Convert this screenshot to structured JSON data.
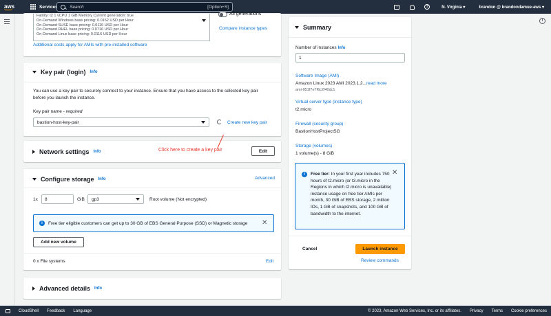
{
  "topnav": {
    "logo": "aws",
    "services_label": "Services",
    "search_placeholder": "Search",
    "search_shortcut": "[Option+S]",
    "region": "N. Virginia ▾",
    "user": "brandon @ brandondamue-aws ▾"
  },
  "ami": {
    "details": [
      "Family: t2    1 vCPU    1 GiB Memory    Current generation: true",
      "On-Demand Windows base pricing: 0.0162 USD per Hour",
      "On-Demand SUSE base pricing: 0.0116 USD per Hour",
      "On-Demand RHEL base pricing: 0.0716 USD per Hour",
      "On-Demand Linux base pricing: 0.0116 USD per Hour"
    ],
    "all_generations": "All generations",
    "compare_link": "Compare instance types",
    "costs_link": "Additional costs apply for AMIs with pre-installed software"
  },
  "keypair": {
    "title": "Key pair (login)",
    "info": "Info",
    "description": "You can use a key pair to securely connect to your instance. Ensure that you have access to the selected key pair before you launch the instance.",
    "field_label": "Key pair name - ",
    "field_required": "required",
    "value": "bastion-host-key-pair",
    "create_link": "Create new key pair"
  },
  "network": {
    "title": "Network settings",
    "info": "Info",
    "edit_label": "Edit"
  },
  "annotation": {
    "text": "Click here  to create a key pair"
  },
  "storage": {
    "title": "Configure storage",
    "info": "Info",
    "advanced_link": "Advanced",
    "count": "1x",
    "size": "8",
    "unit": "GiB",
    "type": "gp3",
    "root_label": "Root volume  (Not encrypted)",
    "notice": "Free tier eligible customers can get up to 30 GB of EBS General Purpose (SSD) or Magnetic storage",
    "add_volume": "Add new volume",
    "filesystems": "0 x File systems",
    "edit_label": "Edit"
  },
  "advanced": {
    "title": "Advanced details",
    "info": "Info"
  },
  "summary": {
    "title": "Summary",
    "instances_label": "Number of instances",
    "info": "Info",
    "instances_value": "1",
    "ami_label": "Software Image (AMI)",
    "ami_value": "Amazon Linux 2023 AMI 2023.1.2...",
    "ami_more": "read more",
    "ami_id": "ami-051f7e7f6c2f40dc1",
    "server_label": "Virtual server type (instance type)",
    "server_value": "t2.micro",
    "firewall_label": "Firewall (security group)",
    "firewall_value": "BastionHostProjectSG",
    "storage_label": "Storage (volumes)",
    "storage_value": "1 volume(s) - 8 GiB",
    "free_tier_bold": "Free tier:",
    "free_tier_text": " In your first year includes 750 hours of t2.micro (or t3.micro in the Regions in which t2.micro is unavailable) instance usage on free tier AMIs per month, 30 GiB of EBS storage, 2 million IOs, 1 GB of snapshots, and 100 GB of bandwidth to the internet.",
    "cancel_label": "Cancel",
    "launch_label": "Launch instance",
    "review_link": "Review commands"
  },
  "footer": {
    "cloudshell": "CloudShell",
    "feedback": "Feedback",
    "language": "Language",
    "copyright": "© 2023, Amazon Web Services, Inc. or its affiliates.",
    "privacy": "Privacy",
    "terms": "Terms",
    "cookies": "Cookie preferences"
  }
}
